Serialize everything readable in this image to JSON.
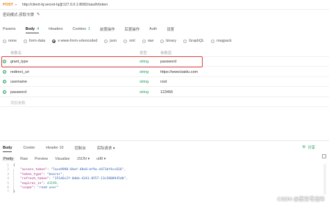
{
  "request": {
    "method": "POST",
    "url": "http://client-lq:secret-lq@127.0.0.1:8082/oauth/token",
    "title": "密码模式-获取令牌"
  },
  "tabs": [
    {
      "label": "Params",
      "count": ""
    },
    {
      "label": "Body",
      "count": "4"
    },
    {
      "label": "Headers",
      "count": ""
    },
    {
      "label": "Cookies",
      "count": "1"
    },
    {
      "label": "前置操作",
      "count": ""
    },
    {
      "label": "后置操作",
      "count": ""
    },
    {
      "label": "Auth",
      "count": ""
    },
    {
      "label": "设置",
      "count": ""
    }
  ],
  "body_types": [
    "none",
    "form-data",
    "x-www-form-urlencoded",
    "json",
    "xml",
    "raw",
    "binary",
    "GraphQL",
    "msgpack"
  ],
  "table_header": {
    "name": "参数名",
    "type": "类型",
    "value": "参数值"
  },
  "params": [
    {
      "name": "grant_type",
      "type": "string",
      "value": "password"
    },
    {
      "name": "redirect_uri",
      "type": "string",
      "value": "https://www.baidu.com"
    },
    {
      "name": "username",
      "type": "string",
      "value": "root"
    },
    {
      "name": "password",
      "type": "string",
      "value": "123456"
    }
  ],
  "add_param_placeholder": "添加参数",
  "response_tabs": [
    {
      "label": "Body"
    },
    {
      "label": "Cookie"
    },
    {
      "label": "Header 10"
    },
    {
      "label": "控制台"
    },
    {
      "label": "实际请求 ▾"
    }
  ],
  "share_label": "分享",
  "format_options": [
    "Pretty",
    "Raw",
    "Preview",
    "Visualize",
    "JSON ▾",
    "utf8 ▾"
  ],
  "code_lines": [
    {
      "n": "1",
      "k": "",
      "v": "{"
    },
    {
      "n": "2",
      "k": "\"access_token\"",
      "v": "\"7ace9998-84af-48e8-bf9a-4471bf4cc626\","
    },
    {
      "n": "3",
      "k": "\"token_type\"",
      "v": "\"bearer\","
    },
    {
      "n": "4",
      "k": "\"refresh_token\"",
      "v": "\"15146c2f-0dbb-4341-8557-13c5808945d0\","
    },
    {
      "n": "5",
      "k": "\"expires_in\"",
      "v": "43199,"
    },
    {
      "n": "6",
      "k": "\"scope\"",
      "v": "\"read user\""
    },
    {
      "n": "7",
      "k": "",
      "v": "}"
    }
  ],
  "watermark": "CSDN @星空寻流年",
  "colors": {
    "method": "#e8850c",
    "accent": "#1e9d5a",
    "highlight": "#e03b3b"
  }
}
